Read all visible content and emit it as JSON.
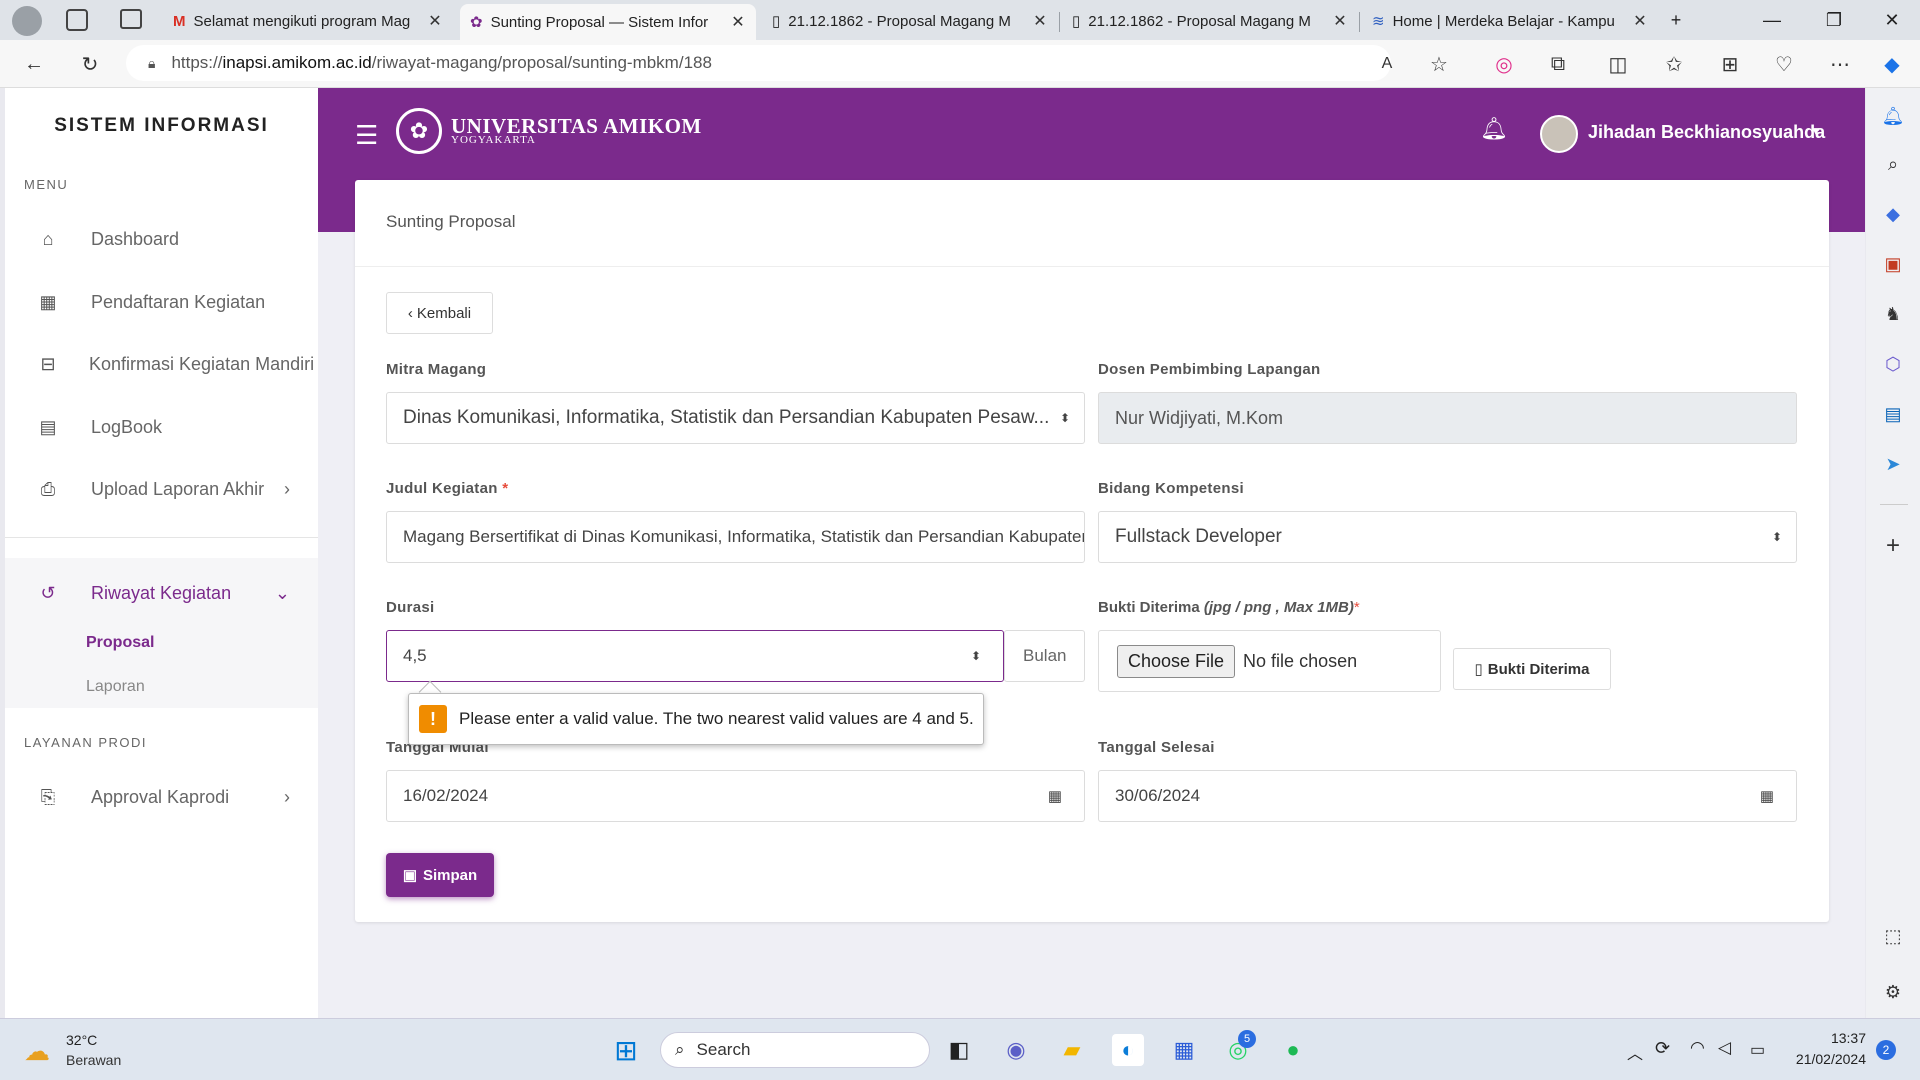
{
  "browser": {
    "tabs": [
      {
        "title": "Selamat mengikuti program Mag",
        "icon": "gmail-icon"
      },
      {
        "title": "Sunting Proposal — Sistem Infor",
        "icon": "amikom-icon",
        "active": true
      },
      {
        "title": "21.12.1862 - Proposal Magang M",
        "icon": "document-icon"
      },
      {
        "title": "21.12.1862 - Proposal Magang M",
        "icon": "document-icon"
      },
      {
        "title": "Home | Merdeka Belajar - Kampu",
        "icon": "kampus-merdeka-icon"
      }
    ],
    "url_prefix": "https://",
    "url_host": "inapsi.amikom.ac.id",
    "url_path": "/riwayat-magang/proposal/sunting-mbkm/188"
  },
  "sidebar": {
    "brand": "SISTEM INFORMASI",
    "menu_label": "MENU",
    "items": [
      {
        "label": "Dashboard"
      },
      {
        "label": "Pendaftaran Kegiatan"
      },
      {
        "label": "Konfirmasi Kegiatan Mandiri"
      },
      {
        "label": "LogBook"
      },
      {
        "label": "Upload Laporan Akhir"
      }
    ],
    "riwayat": {
      "label": "Riwayat Kegiatan",
      "sub": [
        "Proposal",
        "Laporan"
      ]
    },
    "prodi_label": "LAYANAN PRODI",
    "approval": "Approval Kaprodi"
  },
  "header": {
    "logo_name": "UNIVERSITAS AMIKOM",
    "logo_city": "YOGYAKARTA",
    "user_name": "Jihadan Beckhianosyuahda"
  },
  "form": {
    "title": "Sunting Proposal",
    "back_label": "Kembali",
    "mitra_label": "Mitra Magang",
    "mitra_value": "Dinas Komunikasi, Informatika, Statistik dan Persandian Kabupaten Pesaw...",
    "dosen_label": "Dosen Pembimbing Lapangan",
    "dosen_value": "Nur Widjiyati, M.Kom",
    "judul_label": "Judul Kegiatan",
    "judul_value": "Magang Bersertifikat di Dinas Komunikasi, Informatika, Statistik dan Persandian Kabupaten Pesawaran",
    "bidang_label": "Bidang Kompetensi",
    "bidang_value": "Fullstack Developer",
    "durasi_label": "Durasi",
    "durasi_value": "4,5",
    "durasi_unit": "Bulan",
    "bukti_label": "Bukti Diterima",
    "bukti_hint": "(jpg / png , Max 1MB)",
    "choose_file": "Choose File",
    "no_file": "No file chosen",
    "bukti_button": "Bukti Diterima",
    "tanggal_mulai_label": "Tanggal Mulai",
    "tanggal_mulai_value": "16/02/2024",
    "tanggal_selesai_label": "Tanggal Selesai",
    "tanggal_selesai_value": "30/06/2024",
    "simpan": "Simpan",
    "validation_message": "Please enter a valid value. The two nearest valid values are 4 and 5."
  },
  "taskbar": {
    "temp": "32°C",
    "weather": "Berawan",
    "search": "Search",
    "time": "13:37",
    "date": "21/02/2024",
    "whatsapp_badge": "5",
    "notif_count": "2"
  },
  "colors": {
    "brand_purple": "#7b2a8c",
    "warning": "#f08c00"
  }
}
